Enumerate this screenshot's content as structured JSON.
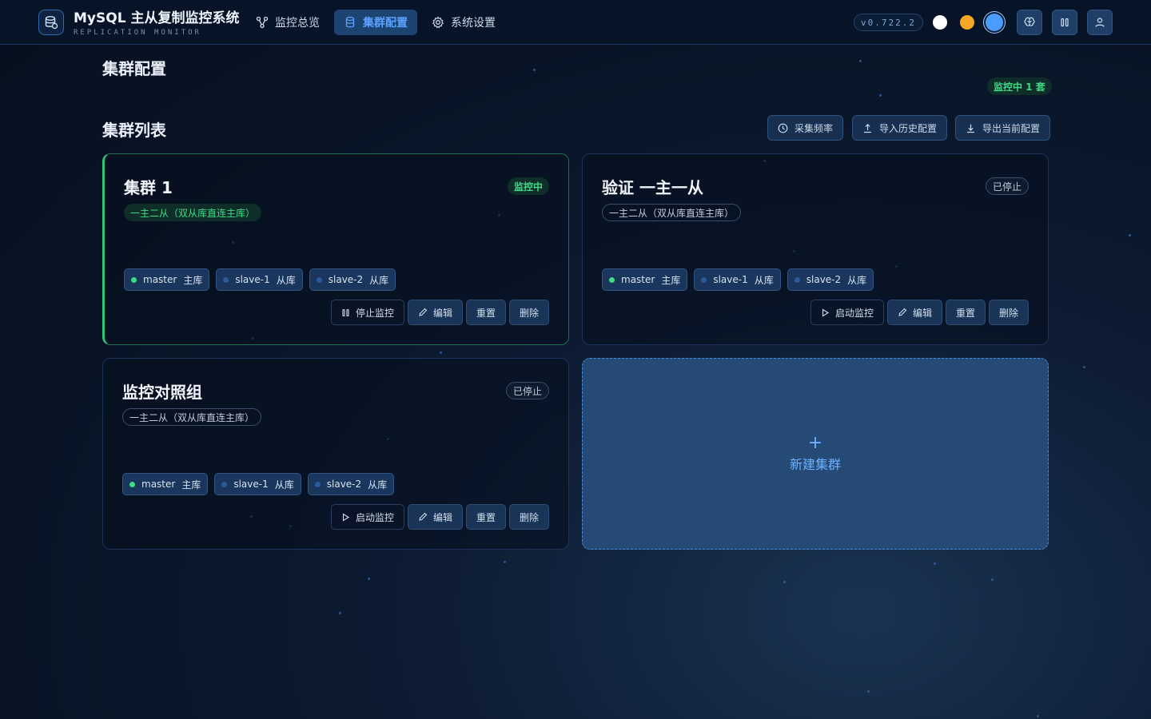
{
  "header": {
    "app_title": "MySQL 主从复制监控系统",
    "app_subtitle": "REPLICATION MONITOR",
    "nav": [
      {
        "label": "监控总览",
        "icon": "topology-icon",
        "active": false
      },
      {
        "label": "集群配置",
        "icon": "database-icon",
        "active": true
      },
      {
        "label": "系统设置",
        "icon": "gear-icon",
        "active": false
      }
    ],
    "version": "v0.722.2",
    "theme_colors": [
      "#ffffff",
      "#f5a623",
      "#4a9dff"
    ]
  },
  "page": {
    "title": "集群配置",
    "monitor_count": "监控中 1 套",
    "section_title": "集群列表"
  },
  "toolbar": {
    "interval_label": "采集频率",
    "import_label": "导入历史配置",
    "export_label": "导出当前配置"
  },
  "clusters": [
    {
      "name": "集群 1",
      "status": "监控中",
      "topology": "一主二从（双从库直连主库）",
      "nodes": [
        {
          "name": "master",
          "role": "主库"
        },
        {
          "name": "slave-1",
          "role": "从库"
        },
        {
          "name": "slave-2",
          "role": "从库"
        }
      ],
      "toggle_label": "停止监控",
      "edit_label": "编辑",
      "reset_label": "重置",
      "delete_label": "删除"
    },
    {
      "name": "验证 一主一从",
      "status": "已停止",
      "topology": "一主二从（双从库直连主库）",
      "nodes": [
        {
          "name": "master",
          "role": "主库"
        },
        {
          "name": "slave-1",
          "role": "从库"
        },
        {
          "name": "slave-2",
          "role": "从库"
        }
      ],
      "toggle_label": "启动监控",
      "edit_label": "编辑",
      "reset_label": "重置",
      "delete_label": "删除"
    },
    {
      "name": "监控对照组",
      "status": "已停止",
      "topology": "一主二从（双从库直连主库）",
      "nodes": [
        {
          "name": "master",
          "role": "主库"
        },
        {
          "name": "slave-1",
          "role": "从库"
        },
        {
          "name": "slave-2",
          "role": "从库"
        }
      ],
      "toggle_label": "启动监控",
      "edit_label": "编辑",
      "reset_label": "重置",
      "delete_label": "删除"
    }
  ],
  "new_cluster": {
    "plus": "+",
    "label": "新建集群"
  },
  "colors": {
    "accent": "#5aa2ff",
    "running": "#3ddc84",
    "master_dot": "#3ddc84",
    "slave_dot": "#2a5a9a"
  }
}
